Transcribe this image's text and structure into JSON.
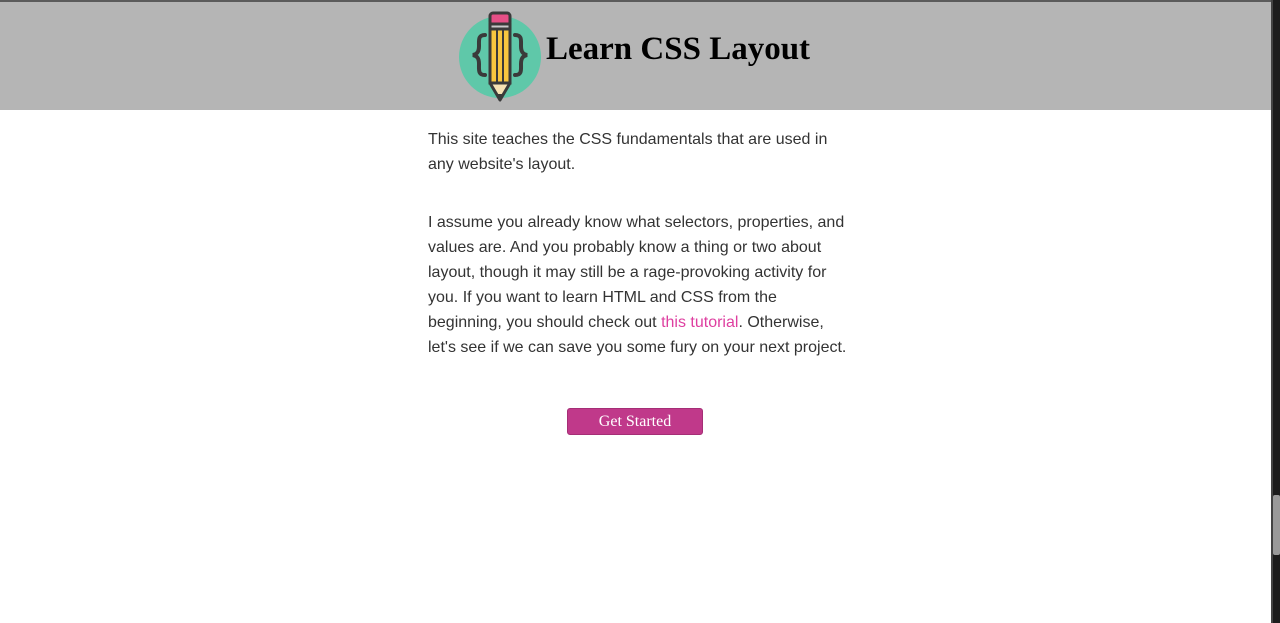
{
  "header": {
    "title": "Learn CSS Layout",
    "logo_icon": "pencil-braces-logo-icon",
    "background": "#b5b5b5"
  },
  "main": {
    "intro": "This site teaches the CSS fundamentals that are used in any website's layout.",
    "para2_before_link": "I assume you already know what selectors, properties, and values are. And you probably know a thing or two about layout, though it may still be a rage-provoking activity for you. If you want to learn HTML and CSS from the beginning, you should check out ",
    "para2_link": "this tutorial",
    "para2_after_link": ". Otherwise, let's see if we can save you some fury on your next project.",
    "link_color": "#de3fa0",
    "text_color": "#333333"
  },
  "cta": {
    "label": "Get Started",
    "color": "#c0398a"
  }
}
